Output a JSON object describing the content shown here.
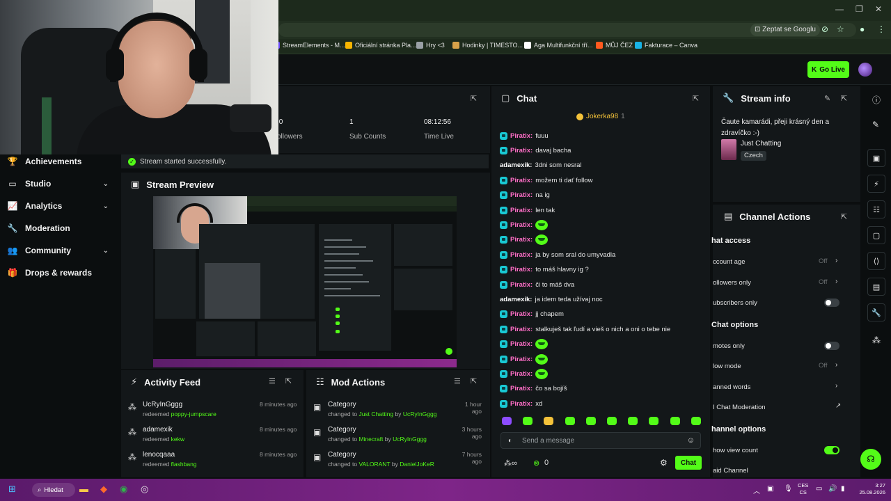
{
  "browser": {
    "ask_google": "Zeptat se Googlu",
    "bookmarks": [
      {
        "label": "StreamElements - M...",
        "color": "#6c4cff"
      },
      {
        "label": "Oficiální stránka Pla...",
        "color": "#f7b500"
      },
      {
        "label": "Hry <3",
        "color": "#9aa0a6"
      },
      {
        "label": "Hodinky | TIMESTO...",
        "color": "#d8a24a"
      },
      {
        "label": "Aga Multifunkční tří...",
        "color": "#ffffff"
      },
      {
        "label": "MŮJ ČEZ",
        "color": "#ff5a1f"
      },
      {
        "label": "Fakturace – Canva",
        "color": "#18b3e6"
      }
    ]
  },
  "header": {
    "go_live": "Go Live"
  },
  "stats": [
    {
      "value": ":0",
      "label": "ollowers"
    },
    {
      "value": "1",
      "label": "Sub Counts"
    },
    {
      "value": "08:12:56",
      "label": "Time Live"
    }
  ],
  "sidebar": {
    "items": [
      {
        "label": "Achievements",
        "icon": "trophy-icon",
        "glyph": "🏆",
        "chevron": false
      },
      {
        "label": "Studio",
        "icon": "studio-icon",
        "glyph": "▭",
        "chevron": true
      },
      {
        "label": "Analytics",
        "icon": "analytics-icon",
        "glyph": "📈",
        "chevron": true
      },
      {
        "label": "Moderation",
        "icon": "wrench-icon",
        "glyph": "🔧",
        "chevron": false
      },
      {
        "label": "Community",
        "icon": "community-icon",
        "glyph": "👥",
        "chevron": true
      },
      {
        "label": "Drops & rewards",
        "icon": "gift-icon",
        "glyph": "🎁",
        "chevron": false
      }
    ]
  },
  "status": {
    "message": "Stream started successfully."
  },
  "preview": {
    "title": "Stream Preview"
  },
  "chat": {
    "title": "Chat",
    "pinned_user": "Jokerka98",
    "pinned_count": "1",
    "messages": [
      {
        "user": "Piratix:",
        "text": "fuuu",
        "badge": true,
        "color": "#ff6ec7",
        "emote": false
      },
      {
        "user": "Piratix:",
        "text": "davaj bacha",
        "badge": true,
        "color": "#ff6ec7",
        "emote": false
      },
      {
        "user": "adamexik:",
        "text": "3dni som nesral",
        "badge": false,
        "color": "#ffffff",
        "emote": false
      },
      {
        "user": "Piratix:",
        "text": "možem ti dať follow",
        "badge": true,
        "color": "#ff6ec7",
        "emote": false
      },
      {
        "user": "Piratix:",
        "text": "na ig",
        "badge": true,
        "color": "#ff6ec7",
        "emote": false
      },
      {
        "user": "Piratix:",
        "text": "len tak",
        "badge": true,
        "color": "#ff6ec7",
        "emote": false
      },
      {
        "user": "Piratix:",
        "text": "",
        "badge": true,
        "color": "#ff6ec7",
        "emote": true
      },
      {
        "user": "Piratix:",
        "text": "",
        "badge": true,
        "color": "#ff6ec7",
        "emote": true
      },
      {
        "user": "Piratix:",
        "text": "ja by som sral do umyvadla",
        "badge": true,
        "color": "#ff6ec7",
        "emote": false
      },
      {
        "user": "Piratix:",
        "text": "to máš hlavny ig ?",
        "badge": true,
        "color": "#ff6ec7",
        "emote": false
      },
      {
        "user": "Piratix:",
        "text": "či to máš dva",
        "badge": true,
        "color": "#ff6ec7",
        "emote": false
      },
      {
        "user": "adamexik:",
        "text": "ja idem teda užívaj noc",
        "badge": false,
        "color": "#ffffff",
        "emote": false
      },
      {
        "user": "Piratix:",
        "text": "jj chapem",
        "badge": true,
        "color": "#ff6ec7",
        "emote": false
      },
      {
        "user": "Piratix:",
        "text": "stalkuješ tak ľudí a vieš o nich a oni o tebe nie",
        "badge": true,
        "color": "#ff6ec7",
        "emote": false
      },
      {
        "user": "Piratix:",
        "text": "",
        "badge": true,
        "color": "#ff6ec7",
        "emote": true
      },
      {
        "user": "Piratix:",
        "text": "",
        "badge": true,
        "color": "#ff6ec7",
        "emote": true
      },
      {
        "user": "Piratix:",
        "text": "",
        "badge": true,
        "color": "#ff6ec7",
        "emote": true
      },
      {
        "user": "Piratix:",
        "text": "čo sa bojíš",
        "badge": true,
        "color": "#ff6ec7",
        "emote": false
      },
      {
        "user": "Piratix:",
        "text": "xd",
        "badge": true,
        "color": "#ff6ec7",
        "emote": false
      }
    ],
    "input_placeholder": "Send a message",
    "send_label": "Chat",
    "kicks_count": "0"
  },
  "stream_info": {
    "title_label": "Stream info",
    "stream_title": "Čaute kamarádi, přeji krásný den a zdravíčko :-)",
    "category": "Just Chatting",
    "language": "Czech"
  },
  "channel_actions": {
    "title": "Channel Actions",
    "sections": [
      {
        "heading": "hat access",
        "rows": [
          {
            "label": "ccount age",
            "state": "Off",
            "control": "chevron"
          },
          {
            "label": "ollowers only",
            "state": "Off",
            "control": "chevron"
          },
          {
            "label": "ubscribers only",
            "state": "",
            "control": "toggle-off"
          }
        ]
      },
      {
        "heading": "Chat options",
        "rows": [
          {
            "label": "motes only",
            "state": "",
            "control": "toggle-off"
          },
          {
            "label": "low mode",
            "state": "Off",
            "control": "chevron"
          },
          {
            "label": "anned words",
            "state": "",
            "control": "chevron"
          },
          {
            "label": "I Chat Moderation",
            "state": "",
            "control": "external"
          }
        ]
      },
      {
        "heading": "hannel options",
        "rows": [
          {
            "label": "how view count",
            "state": "",
            "control": "toggle-on"
          },
          {
            "label": "aid Channel",
            "state": "",
            "control": "none"
          }
        ]
      }
    ]
  },
  "activity_feed": {
    "title": "Activity Feed",
    "items": [
      {
        "user": "UcRyInGggg",
        "action": "redeemed",
        "reward": "poppy-jumpscare",
        "time": "8 minutes ago"
      },
      {
        "user": "adamexik",
        "action": "redeemed",
        "reward": "kekw",
        "time": "8 minutes ago"
      },
      {
        "user": "lenocqaaa",
        "action": "redeemed",
        "reward": "flashbang",
        "time": "8 minutes ago"
      }
    ]
  },
  "mod_actions": {
    "title": "Mod Actions",
    "items": [
      {
        "title": "Category",
        "prefix": "changed to",
        "value": "Just Chatting",
        "by": "by",
        "moderator": "UcRyInGggg",
        "time": "1 hour ago"
      },
      {
        "title": "Category",
        "prefix": "changed to",
        "value": "Minecraft",
        "by": "by",
        "moderator": "UcRyInGggg",
        "time": "3 hours ago"
      },
      {
        "title": "Category",
        "prefix": "changed to",
        "value": "VALORANT",
        "by": "by",
        "moderator": "DanielJoKeR",
        "time": "7 hours ago"
      }
    ]
  },
  "taskbar": {
    "search_label": "Hledat",
    "lang_top": "CES",
    "lang_bottom": "CS",
    "time": "3:27",
    "date": "25.08.2026"
  },
  "colors": {
    "accent": "#53fc18",
    "panel": "#131719",
    "background": "#0b0e0f"
  }
}
